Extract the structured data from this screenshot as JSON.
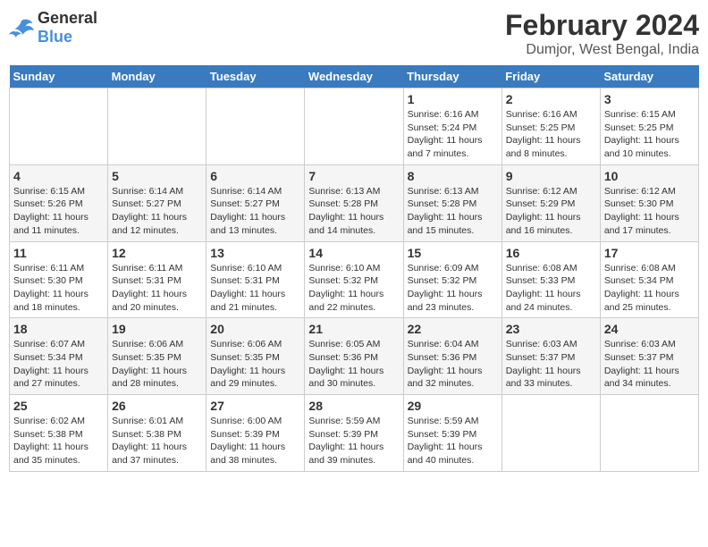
{
  "header": {
    "logo_line1": "General",
    "logo_line2": "Blue",
    "month_title": "February 2024",
    "location": "Dumjor, West Bengal, India"
  },
  "weekdays": [
    "Sunday",
    "Monday",
    "Tuesday",
    "Wednesday",
    "Thursday",
    "Friday",
    "Saturday"
  ],
  "weeks": [
    [
      {
        "day": "",
        "detail": ""
      },
      {
        "day": "",
        "detail": ""
      },
      {
        "day": "",
        "detail": ""
      },
      {
        "day": "",
        "detail": ""
      },
      {
        "day": "1",
        "detail": "Sunrise: 6:16 AM\nSunset: 5:24 PM\nDaylight: 11 hours\nand 7 minutes."
      },
      {
        "day": "2",
        "detail": "Sunrise: 6:16 AM\nSunset: 5:25 PM\nDaylight: 11 hours\nand 8 minutes."
      },
      {
        "day": "3",
        "detail": "Sunrise: 6:15 AM\nSunset: 5:25 PM\nDaylight: 11 hours\nand 10 minutes."
      }
    ],
    [
      {
        "day": "4",
        "detail": "Sunrise: 6:15 AM\nSunset: 5:26 PM\nDaylight: 11 hours\nand 11 minutes."
      },
      {
        "day": "5",
        "detail": "Sunrise: 6:14 AM\nSunset: 5:27 PM\nDaylight: 11 hours\nand 12 minutes."
      },
      {
        "day": "6",
        "detail": "Sunrise: 6:14 AM\nSunset: 5:27 PM\nDaylight: 11 hours\nand 13 minutes."
      },
      {
        "day": "7",
        "detail": "Sunrise: 6:13 AM\nSunset: 5:28 PM\nDaylight: 11 hours\nand 14 minutes."
      },
      {
        "day": "8",
        "detail": "Sunrise: 6:13 AM\nSunset: 5:28 PM\nDaylight: 11 hours\nand 15 minutes."
      },
      {
        "day": "9",
        "detail": "Sunrise: 6:12 AM\nSunset: 5:29 PM\nDaylight: 11 hours\nand 16 minutes."
      },
      {
        "day": "10",
        "detail": "Sunrise: 6:12 AM\nSunset: 5:30 PM\nDaylight: 11 hours\nand 17 minutes."
      }
    ],
    [
      {
        "day": "11",
        "detail": "Sunrise: 6:11 AM\nSunset: 5:30 PM\nDaylight: 11 hours\nand 18 minutes."
      },
      {
        "day": "12",
        "detail": "Sunrise: 6:11 AM\nSunset: 5:31 PM\nDaylight: 11 hours\nand 20 minutes."
      },
      {
        "day": "13",
        "detail": "Sunrise: 6:10 AM\nSunset: 5:31 PM\nDaylight: 11 hours\nand 21 minutes."
      },
      {
        "day": "14",
        "detail": "Sunrise: 6:10 AM\nSunset: 5:32 PM\nDaylight: 11 hours\nand 22 minutes."
      },
      {
        "day": "15",
        "detail": "Sunrise: 6:09 AM\nSunset: 5:32 PM\nDaylight: 11 hours\nand 23 minutes."
      },
      {
        "day": "16",
        "detail": "Sunrise: 6:08 AM\nSunset: 5:33 PM\nDaylight: 11 hours\nand 24 minutes."
      },
      {
        "day": "17",
        "detail": "Sunrise: 6:08 AM\nSunset: 5:34 PM\nDaylight: 11 hours\nand 25 minutes."
      }
    ],
    [
      {
        "day": "18",
        "detail": "Sunrise: 6:07 AM\nSunset: 5:34 PM\nDaylight: 11 hours\nand 27 minutes."
      },
      {
        "day": "19",
        "detail": "Sunrise: 6:06 AM\nSunset: 5:35 PM\nDaylight: 11 hours\nand 28 minutes."
      },
      {
        "day": "20",
        "detail": "Sunrise: 6:06 AM\nSunset: 5:35 PM\nDaylight: 11 hours\nand 29 minutes."
      },
      {
        "day": "21",
        "detail": "Sunrise: 6:05 AM\nSunset: 5:36 PM\nDaylight: 11 hours\nand 30 minutes."
      },
      {
        "day": "22",
        "detail": "Sunrise: 6:04 AM\nSunset: 5:36 PM\nDaylight: 11 hours\nand 32 minutes."
      },
      {
        "day": "23",
        "detail": "Sunrise: 6:03 AM\nSunset: 5:37 PM\nDaylight: 11 hours\nand 33 minutes."
      },
      {
        "day": "24",
        "detail": "Sunrise: 6:03 AM\nSunset: 5:37 PM\nDaylight: 11 hours\nand 34 minutes."
      }
    ],
    [
      {
        "day": "25",
        "detail": "Sunrise: 6:02 AM\nSunset: 5:38 PM\nDaylight: 11 hours\nand 35 minutes."
      },
      {
        "day": "26",
        "detail": "Sunrise: 6:01 AM\nSunset: 5:38 PM\nDaylight: 11 hours\nand 37 minutes."
      },
      {
        "day": "27",
        "detail": "Sunrise: 6:00 AM\nSunset: 5:39 PM\nDaylight: 11 hours\nand 38 minutes."
      },
      {
        "day": "28",
        "detail": "Sunrise: 5:59 AM\nSunset: 5:39 PM\nDaylight: 11 hours\nand 39 minutes."
      },
      {
        "day": "29",
        "detail": "Sunrise: 5:59 AM\nSunset: 5:39 PM\nDaylight: 11 hours\nand 40 minutes."
      },
      {
        "day": "",
        "detail": ""
      },
      {
        "day": "",
        "detail": ""
      }
    ]
  ]
}
